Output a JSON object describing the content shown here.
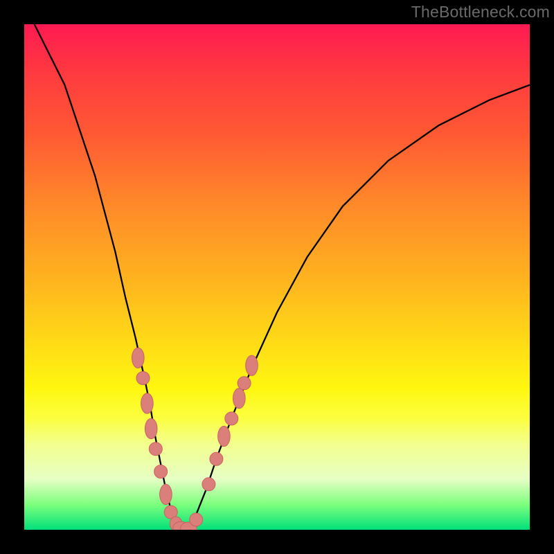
{
  "watermark": "TheBottleneck.com",
  "chart_data": {
    "type": "line",
    "title": "",
    "xlabel": "",
    "ylabel": "",
    "xlim": [
      0,
      100
    ],
    "ylim": [
      0,
      100
    ],
    "grid": false,
    "background_gradient": {
      "top_color": "#ff1a52",
      "bottom_color": "#00e07a"
    },
    "series": [
      {
        "name": "bottleneck-curve",
        "color": "#000000",
        "x": [
          2,
          8,
          14,
          18,
          20,
          22,
          24,
          25,
          26,
          27,
          28,
          29,
          30,
          31,
          32,
          33,
          34,
          36,
          38,
          41,
          45,
          50,
          56,
          63,
          72,
          82,
          92,
          100
        ],
        "values": [
          100,
          88,
          70,
          55,
          46,
          38,
          29,
          24,
          18,
          13,
          8,
          4,
          1,
          0,
          0,
          1,
          3,
          8,
          14,
          22,
          32,
          43,
          54,
          64,
          73,
          80,
          85,
          88
        ]
      }
    ],
    "annotations": [
      {
        "name": "marker-ellipse",
        "x": 22.5,
        "y": 34,
        "rx": 1.2,
        "ry": 2.0
      },
      {
        "name": "marker-circle",
        "x": 23.5,
        "y": 30,
        "r": 1.3
      },
      {
        "name": "marker-ellipse",
        "x": 24.3,
        "y": 25,
        "rx": 1.2,
        "ry": 2.0
      },
      {
        "name": "marker-ellipse",
        "x": 25.1,
        "y": 20,
        "rx": 1.2,
        "ry": 2.0
      },
      {
        "name": "marker-circle",
        "x": 26.0,
        "y": 16,
        "r": 1.3
      },
      {
        "name": "marker-circle",
        "x": 27.0,
        "y": 11.5,
        "r": 1.3
      },
      {
        "name": "marker-ellipse",
        "x": 28.0,
        "y": 7,
        "rx": 1.2,
        "ry": 2.0
      },
      {
        "name": "marker-circle",
        "x": 29.0,
        "y": 3.5,
        "r": 1.3
      },
      {
        "name": "marker-ellipse",
        "x": 30.0,
        "y": 1.2,
        "rx": 1.2,
        "ry": 1.4
      },
      {
        "name": "marker-ellipse",
        "x": 31.0,
        "y": 0.4,
        "rx": 1.6,
        "ry": 1.2
      },
      {
        "name": "marker-ellipse",
        "x": 32.5,
        "y": 0.3,
        "rx": 1.6,
        "ry": 1.2
      },
      {
        "name": "marker-circle",
        "x": 34.0,
        "y": 2.0,
        "r": 1.3
      },
      {
        "name": "marker-circle",
        "x": 36.5,
        "y": 9.0,
        "r": 1.3
      },
      {
        "name": "marker-circle",
        "x": 38.0,
        "y": 14.0,
        "r": 1.3
      },
      {
        "name": "marker-ellipse",
        "x": 39.5,
        "y": 18.5,
        "rx": 1.2,
        "ry": 2.0
      },
      {
        "name": "marker-circle",
        "x": 41.0,
        "y": 22.0,
        "r": 1.3
      },
      {
        "name": "marker-ellipse",
        "x": 42.5,
        "y": 26.0,
        "rx": 1.2,
        "ry": 2.0
      },
      {
        "name": "marker-circle",
        "x": 43.5,
        "y": 29.0,
        "r": 1.3
      },
      {
        "name": "marker-ellipse",
        "x": 45.0,
        "y": 32.5,
        "rx": 1.2,
        "ry": 2.0
      }
    ]
  }
}
